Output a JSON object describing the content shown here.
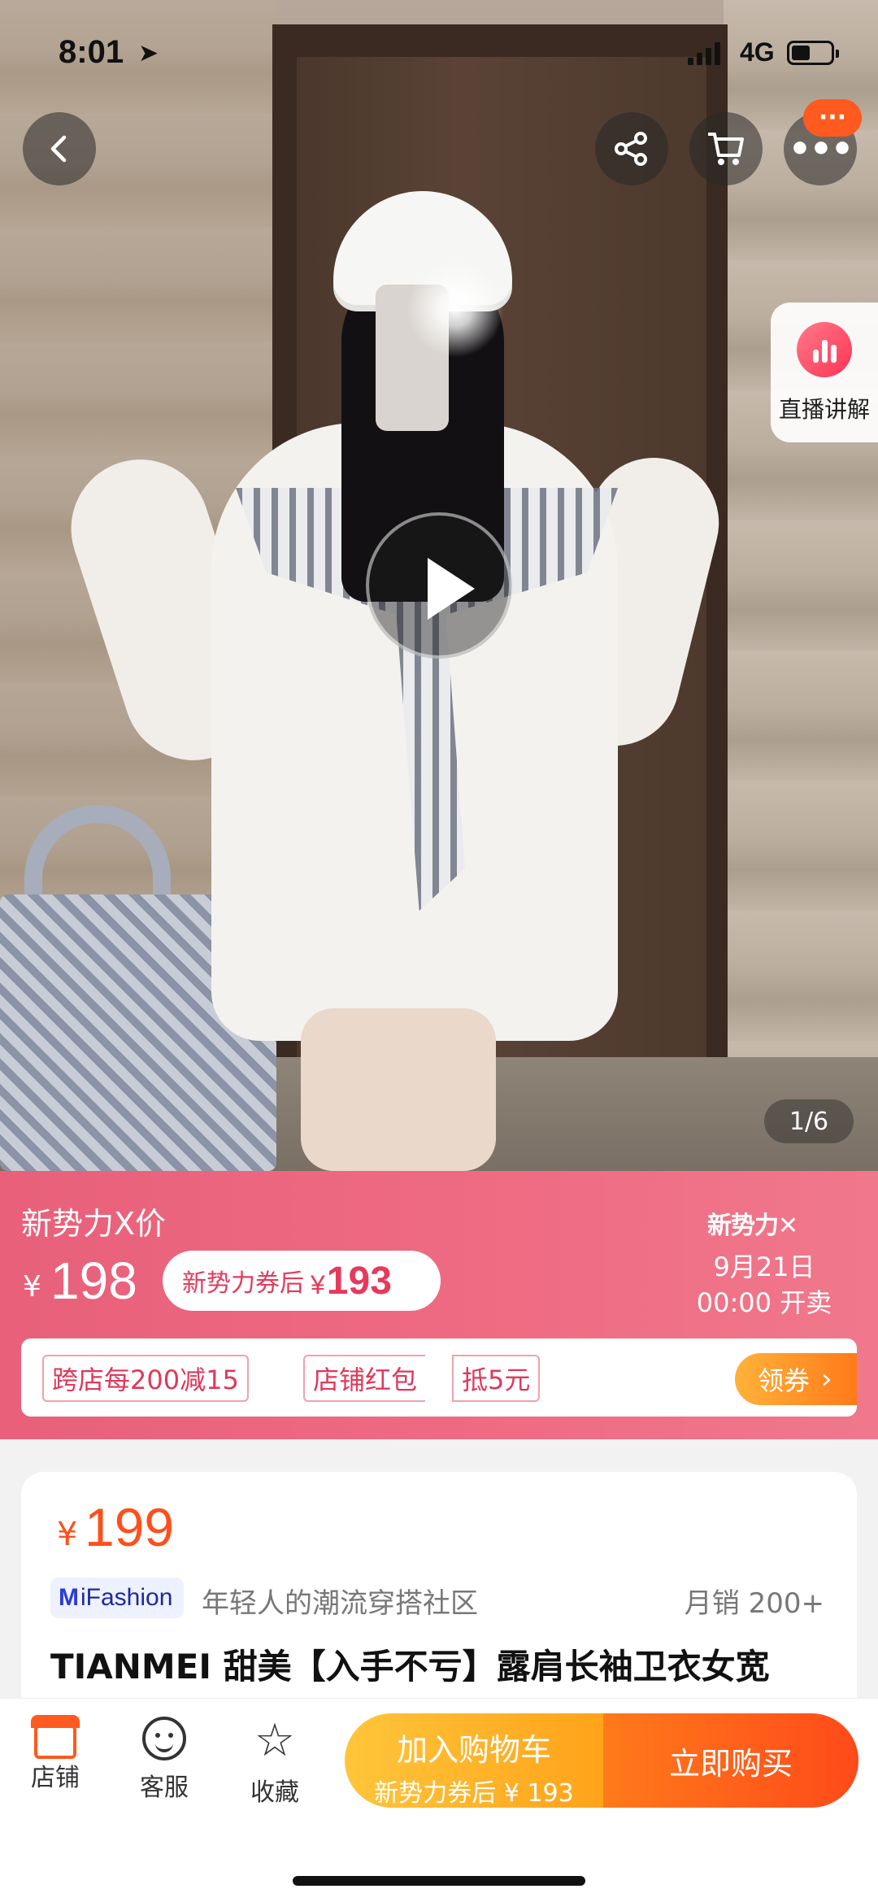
{
  "status_bar": {
    "time": "8:01",
    "network": "4G"
  },
  "hero": {
    "more_badge": "···",
    "live_label": "直播讲解",
    "pager": "1/6"
  },
  "promo": {
    "title": "新势力X价",
    "yen": "¥",
    "price": "198",
    "coupon_text": "新势力券后",
    "coupon_yen": "¥",
    "coupon_price": "193",
    "logo": "新势力✕",
    "sale_date": "9月21日",
    "sale_time": "00:00 开卖"
  },
  "coupons": {
    "tag1": "跨店每200减15",
    "tag2": "店铺红包",
    "tag3": "抵5元",
    "claim": "领券",
    "claim_chevron": "›"
  },
  "product": {
    "yen": "¥",
    "price": "199",
    "brand_mark": "M",
    "brand_name": "iFashion",
    "slogan": "年轻人的潮流穿搭社区",
    "sales": "月销 200+",
    "title": "TIANMEI 甜美【入手不亏】露肩长袖卫衣女宽"
  },
  "bottom_bar": {
    "store": "店铺",
    "service": "客服",
    "favorite": "收藏",
    "favorite_glyph": "☆",
    "add_cart": "加入购物车",
    "add_cart_sub": "新势力券后 ¥ 193",
    "buy_now": "立即购买"
  },
  "colors": {
    "accent": "#ff4f1a",
    "promo_pink": "#ec6780",
    "cta_yellow": "#ffb52a"
  }
}
